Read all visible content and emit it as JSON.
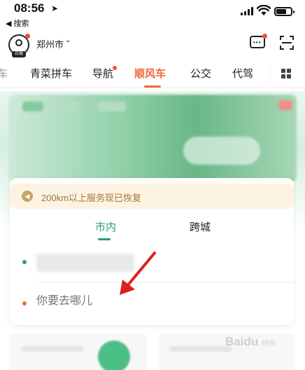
{
  "status_bar": {
    "time": "08:56",
    "back_label": "◀ 搜索"
  },
  "header": {
    "avatar_tag": "白银",
    "city": "郑州市"
  },
  "tabs": [
    {
      "label": "青菜拼车",
      "active": false
    },
    {
      "label": "导航",
      "active": false,
      "has_dot": true
    },
    {
      "label": "顺风车",
      "active": true
    },
    {
      "label": "公交",
      "active": false
    },
    {
      "label": "代驾",
      "active": false
    }
  ],
  "card": {
    "notice": "200km以上服务现已恢复",
    "segments": [
      {
        "label": "市内",
        "active": true
      },
      {
        "label": "跨城",
        "active": false
      }
    ],
    "destination_placeholder": "你要去哪儿"
  },
  "watermark": {
    "text": "Baidu",
    "sub": "经验"
  },
  "colors": {
    "accent_orange": "#f06a38",
    "accent_green": "#2b9f6e",
    "notice_bg": "#fdf3e2",
    "notice_text": "#a0773a",
    "annotation_red": "#e02020"
  }
}
